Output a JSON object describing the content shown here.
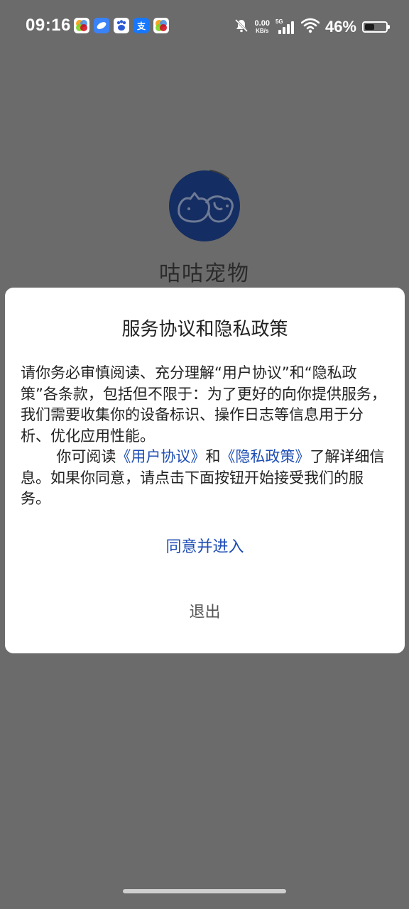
{
  "status_bar": {
    "time": "09:16",
    "app_icons": [
      "multicolor-app-icon",
      "blue-app-icon",
      "baidu-icon",
      "alipay-icon",
      "multicolor-app-icon"
    ],
    "alipay_glyph": "支",
    "net_speed_value": "0.00",
    "net_speed_unit": "KB/s",
    "network_type": "5G",
    "battery_percent": "46%",
    "battery_level": 0.46
  },
  "splash": {
    "app_name": "咕咕宠物"
  },
  "dialog": {
    "title": "服务协议和隐私政策",
    "para1": "请你务必审慎阅读、充分理解“用户协议”和“隐私政策”各条款，包括但不限于：为了更好的向你提供服务，我们需要收集你的设备标识、操作日志等信息用于分析、优化应用性能。",
    "para2_prefix": "你可阅读",
    "user_agreement_link": "《用户协议》",
    "para2_and": "和",
    "privacy_policy_link": "《隐私政策》",
    "para2_suffix": "了解详细信息。如果你同意，请点击下面按钮开始接受我们的服务。",
    "agree_label": "同意并进入",
    "exit_label": "退出"
  },
  "colors": {
    "overlay": "#6b6b6b",
    "logo_bg": "#142d62",
    "link": "#1f4eb4",
    "dialog_bg": "#ffffff"
  }
}
